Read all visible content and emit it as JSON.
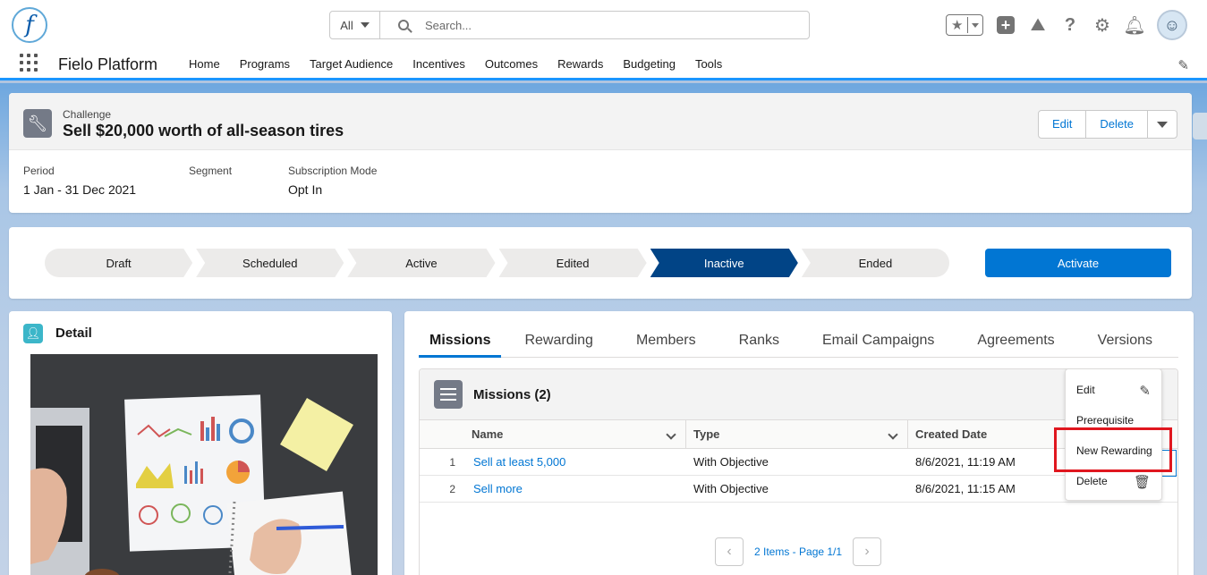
{
  "header": {
    "logo_letter": "f",
    "search_scope": "All",
    "search_placeholder": "Search..."
  },
  "nav": {
    "app_name": "Fielo Platform",
    "items": [
      "Home",
      "Programs",
      "Target Audience",
      "Incentives",
      "Outcomes",
      "Rewards",
      "Budgeting",
      "Tools"
    ]
  },
  "record": {
    "type": "Challenge",
    "title": "Sell $20,000 worth of all-season tires",
    "edit_label": "Edit",
    "delete_label": "Delete",
    "fields": {
      "period_label": "Period",
      "period_value": "1 Jan - 31 Dec 2021",
      "segment_label": "Segment",
      "segment_value": "",
      "subscription_label": "Subscription Mode",
      "subscription_value": "Opt In"
    }
  },
  "path": {
    "steps": [
      "Draft",
      "Scheduled",
      "Active",
      "Edited",
      "Inactive",
      "Ended"
    ],
    "current": "Inactive",
    "action_label": "Activate"
  },
  "detail": {
    "title": "Detail"
  },
  "tabs": [
    "Missions",
    "Rewarding",
    "Members",
    "Ranks",
    "Email Campaigns",
    "Agreements",
    "Versions"
  ],
  "missions": {
    "title": "Missions (2)",
    "columns": [
      "Name",
      "Type",
      "Created Date"
    ],
    "rows": [
      {
        "num": "1",
        "name": "Sell at least 5,000",
        "type": "With Objective",
        "date": "8/6/2021, 11:19 AM"
      },
      {
        "num": "2",
        "name": "Sell more",
        "type": "With Objective",
        "date": "8/6/2021, 11:15 AM"
      }
    ],
    "pager_text": "2 Items - Page 1/1"
  },
  "row_menu": {
    "items": [
      "Edit",
      "Prerequisite",
      "New Rewarding",
      "Delete"
    ]
  },
  "colors": {
    "brand": "#0176d3",
    "path_current": "#014486",
    "highlight": "#e0171f"
  }
}
